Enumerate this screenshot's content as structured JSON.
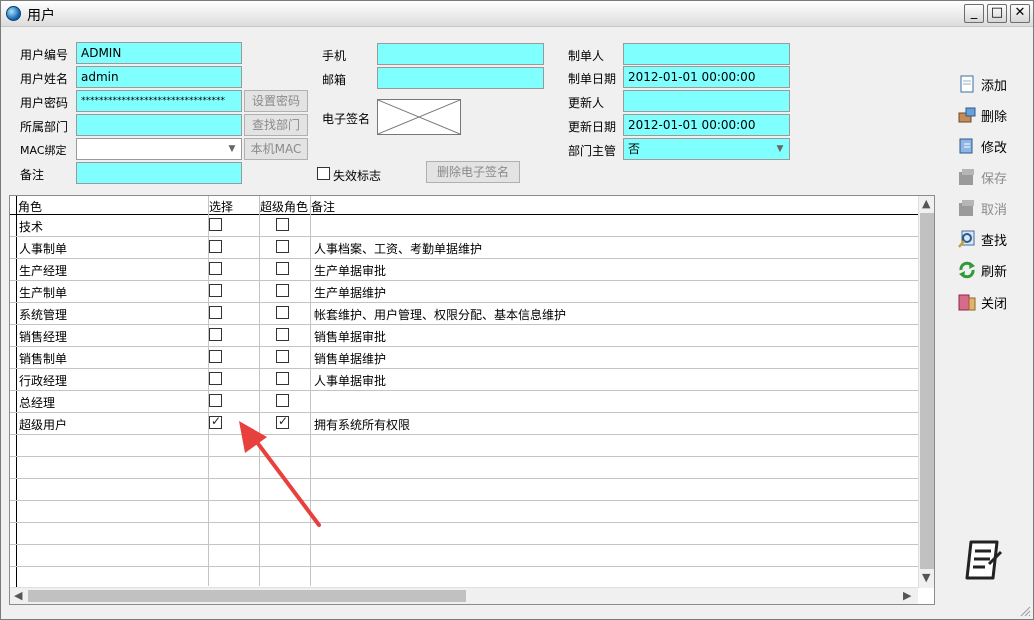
{
  "window": {
    "title": "用户"
  },
  "form": {
    "user_code_label": "用户编号",
    "user_code": "ADMIN",
    "user_name_label": "用户姓名",
    "user_name": "admin",
    "password_label": "用户密码",
    "password": "********************************",
    "dept_label": "所属部门",
    "dept": "",
    "mac_label": "MAC绑定",
    "mac": "",
    "remark_label": "备注",
    "remark": "",
    "phone_label": "手机",
    "phone": "",
    "email_label": "邮箱",
    "email": "",
    "esign_label": "电子签名",
    "creator_label": "制单人",
    "creator": "",
    "create_date_label": "制单日期",
    "create_date": "2012-01-01 00:00:00",
    "updater_label": "更新人",
    "updater": "",
    "update_date_label": "更新日期",
    "update_date": "2012-01-01 00:00:00",
    "dept_head_label": "部门主管",
    "dept_head": "否",
    "invalid_label": "失效标志",
    "invalid_checked": false,
    "set_password_btn": "设置密码",
    "find_dept_btn": "查找部门",
    "local_mac_btn": "本机MAC",
    "delete_esign_btn": "删除电子签名"
  },
  "grid": {
    "columns": [
      "角色",
      "选择",
      "超级角色",
      "备注"
    ],
    "rows": [
      {
        "role": "技术",
        "select": false,
        "super": false,
        "note": ""
      },
      {
        "role": "人事制单",
        "select": false,
        "super": false,
        "note": "人事档案、工资、考勤单据维护"
      },
      {
        "role": "生产经理",
        "select": false,
        "super": false,
        "note": "生产单据审批"
      },
      {
        "role": "生产制单",
        "select": false,
        "super": false,
        "note": "生产单据维护"
      },
      {
        "role": "系统管理",
        "select": false,
        "super": false,
        "note": "帐套维护、用户管理、权限分配、基本信息维护"
      },
      {
        "role": "销售经理",
        "select": false,
        "super": false,
        "note": "销售单据审批"
      },
      {
        "role": "销售制单",
        "select": false,
        "super": false,
        "note": "销售单据维护"
      },
      {
        "role": "行政经理",
        "select": false,
        "super": false,
        "note": "人事单据审批"
      },
      {
        "role": "总经理",
        "select": false,
        "super": false,
        "note": ""
      },
      {
        "role": "超级用户",
        "select": true,
        "super": true,
        "note": "拥有系统所有权限"
      }
    ]
  },
  "toolbar": {
    "add": "添加",
    "delete": "删除",
    "edit": "修改",
    "save": "保存",
    "cancel": "取消",
    "find": "查找",
    "refresh": "刷新",
    "close": "关闭"
  },
  "colors": {
    "field_bg": "#80ffff",
    "annotation_arrow": "#e8403c"
  }
}
